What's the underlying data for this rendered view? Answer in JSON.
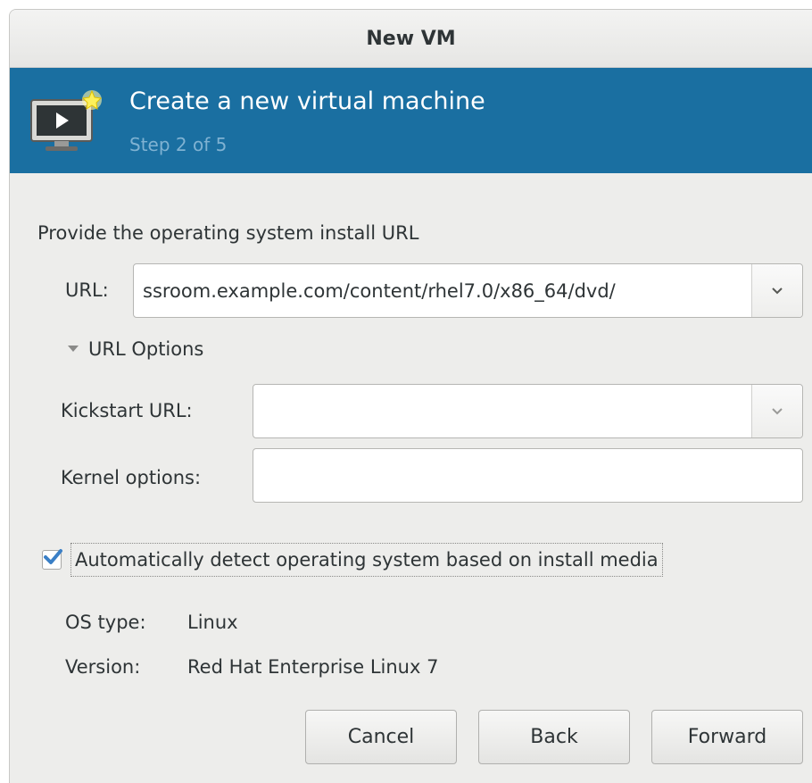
{
  "window": {
    "title": "New VM"
  },
  "banner": {
    "title": "Create a new virtual machine",
    "step": "Step 2 of 5"
  },
  "section_label": "Provide the operating system install URL",
  "url": {
    "label": "URL:",
    "value": "ssroom.example.com/content/rhel7.0/x86_64/dvd/"
  },
  "url_options": {
    "label": "URL Options",
    "kickstart_label": "Kickstart URL:",
    "kickstart_value": "",
    "kernel_label": "Kernel options:",
    "kernel_value": ""
  },
  "autodetect": {
    "label": "Automatically detect operating system based on install media",
    "checked": true
  },
  "os": {
    "type_label": "OS type:",
    "type_value": "Linux",
    "version_label": "Version:",
    "version_value": "Red Hat Enterprise Linux 7"
  },
  "buttons": {
    "cancel": "Cancel",
    "back": "Back",
    "forward": "Forward"
  },
  "colors": {
    "banner": "#1a6fa1",
    "banner_step": "#7fb2d2",
    "check": "#3a7fc6"
  },
  "icons": {
    "banner": "vm-monitor-icon",
    "dropdown": "chevron-down-icon",
    "expander": "triangle-down-icon",
    "check": "checkmark-icon"
  }
}
